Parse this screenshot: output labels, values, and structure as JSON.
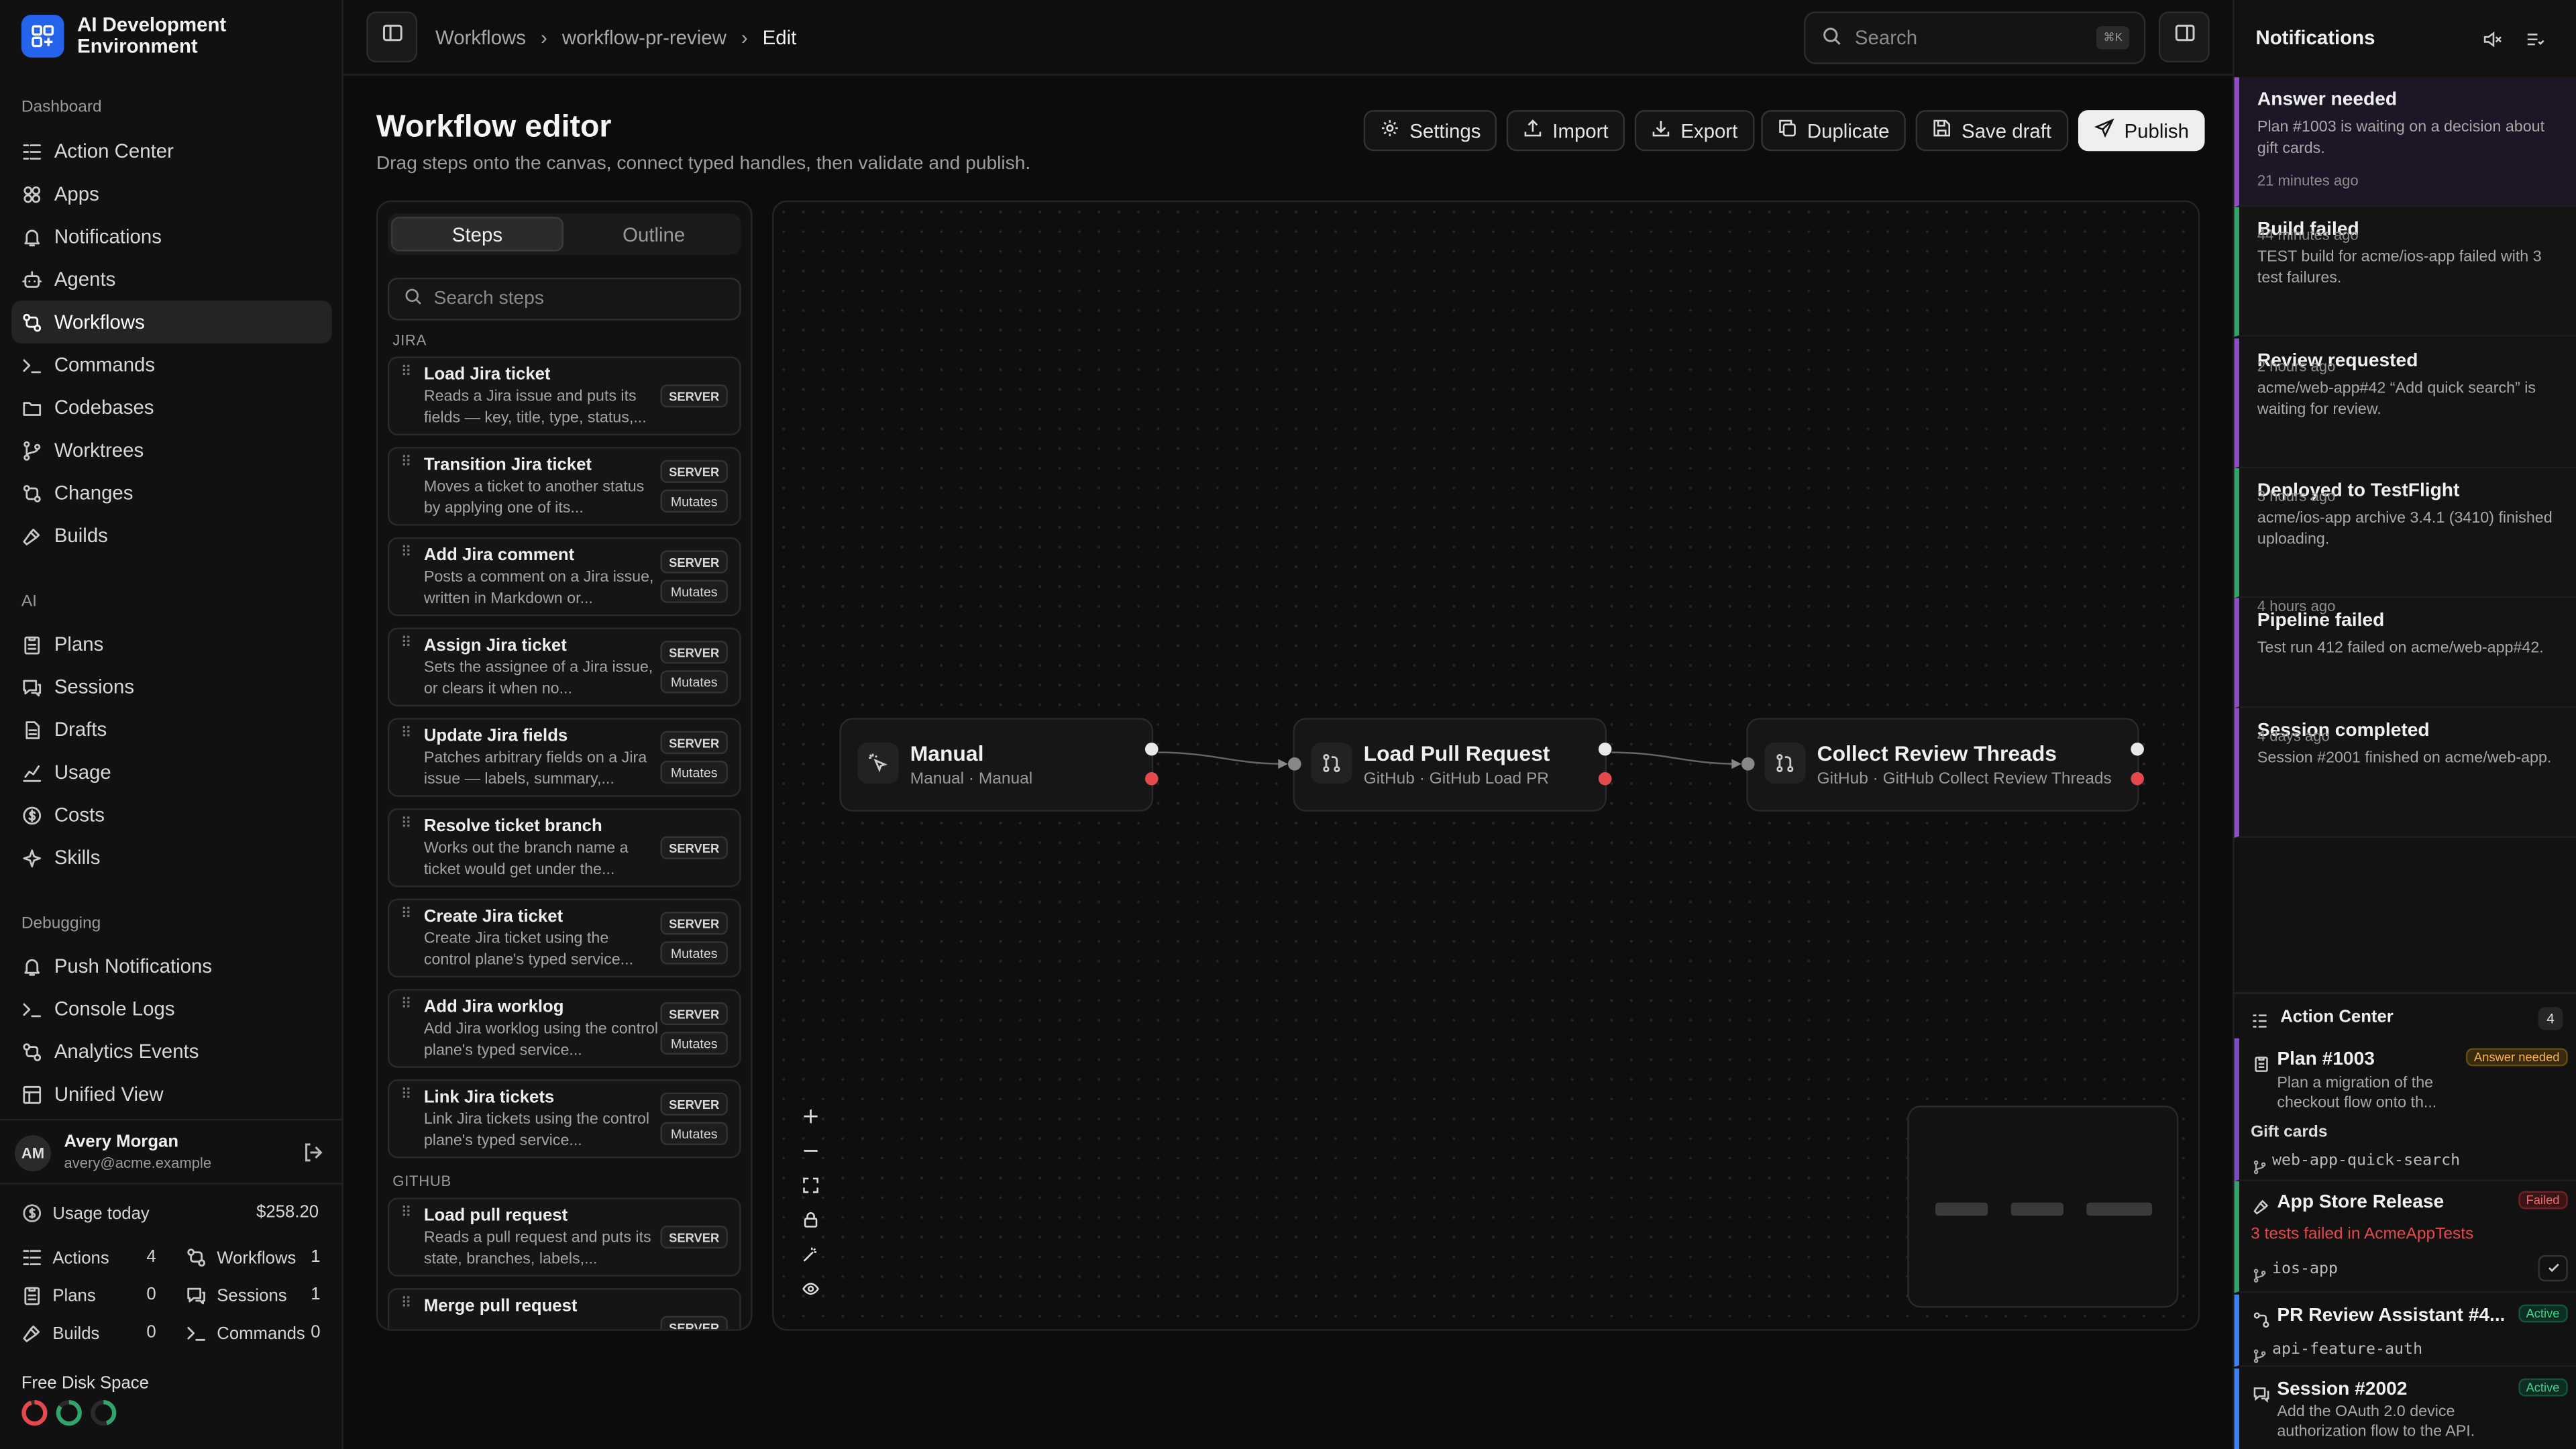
{
  "app": {
    "name": "AI Development Environment"
  },
  "sidebar": {
    "sections": [
      {
        "title": "Dashboard",
        "items": [
          {
            "label": "Action Center",
            "icon": "list-icon"
          },
          {
            "label": "Apps",
            "icon": "apps-icon"
          },
          {
            "label": "Notifications",
            "icon": "bell-icon"
          },
          {
            "label": "Agents",
            "icon": "bot-icon"
          },
          {
            "label": "Workflows",
            "icon": "workflow-icon",
            "active": true
          },
          {
            "label": "Commands",
            "icon": "terminal-icon"
          },
          {
            "label": "Codebases",
            "icon": "folder-icon"
          },
          {
            "label": "Worktrees",
            "icon": "branch-icon"
          },
          {
            "label": "Changes",
            "icon": "git-compare-icon"
          },
          {
            "label": "Builds",
            "icon": "hammer-icon"
          }
        ]
      },
      {
        "title": "AI",
        "items": [
          {
            "label": "Plans",
            "icon": "clipboard-icon"
          },
          {
            "label": "Sessions",
            "icon": "chat-icon"
          },
          {
            "label": "Drafts",
            "icon": "draft-icon"
          },
          {
            "label": "Usage",
            "icon": "chart-icon"
          },
          {
            "label": "Costs",
            "icon": "dollar-icon"
          },
          {
            "label": "Skills",
            "icon": "sparkle-icon"
          }
        ]
      },
      {
        "title": "Debugging",
        "items": [
          {
            "label": "Push Notifications",
            "icon": "bell-icon"
          },
          {
            "label": "Console Logs",
            "icon": "terminal-icon"
          },
          {
            "label": "Analytics Events",
            "icon": "workflow-icon"
          },
          {
            "label": "Unified View",
            "icon": "layout-icon"
          }
        ]
      }
    ],
    "user": {
      "initials": "AM",
      "name": "Avery Morgan",
      "email": "avery@acme.example"
    },
    "usage": {
      "label": "Usage today",
      "value": "$258.20"
    },
    "stats": [
      {
        "label": "Actions",
        "value": "4"
      },
      {
        "label": "Workflows",
        "value": "1"
      },
      {
        "label": "Plans",
        "value": "0"
      },
      {
        "label": "Sessions",
        "value": "1"
      },
      {
        "label": "Builds",
        "value": "0"
      },
      {
        "label": "Commands",
        "value": "0"
      }
    ],
    "disk": {
      "label": "Free Disk Space",
      "rings": [
        {
          "color": "#e5484d",
          "fraction": 0.95
        },
        {
          "color": "#30a46c",
          "fraction": 0.85
        },
        {
          "color": "#30a46c",
          "fraction": 0.45
        }
      ]
    }
  },
  "topbar": {
    "breadcrumbs": [
      "Workflows",
      "workflow-pr-review",
      "Edit"
    ],
    "search_placeholder": "Search",
    "search_shortcut": "⌘K"
  },
  "editor": {
    "title": "Workflow editor",
    "subtitle": "Drag steps onto the canvas, connect typed handles, then validate and publish.",
    "actions": [
      "Settings",
      "Import",
      "Export",
      "Duplicate",
      "Save draft",
      "Publish"
    ]
  },
  "palette": {
    "tabs": [
      "Steps",
      "Outline"
    ],
    "search_placeholder": "Search steps",
    "groups": [
      {
        "name": "JIRA",
        "items": [
          {
            "title": "Load Jira ticket",
            "desc": "Reads a Jira issue and puts its fields — key, title, type, status,...",
            "badges": [
              "SERVER"
            ]
          },
          {
            "title": "Transition Jira ticket",
            "desc": "Moves a ticket to another status by applying one of its...",
            "badges": [
              "SERVER",
              "Mutates"
            ]
          },
          {
            "title": "Add Jira comment",
            "desc": "Posts a comment on a Jira issue, written in Markdown or...",
            "badges": [
              "SERVER",
              "Mutates"
            ]
          },
          {
            "title": "Assign Jira ticket",
            "desc": "Sets the assignee of a Jira issue, or clears it when no...",
            "badges": [
              "SERVER",
              "Mutates"
            ]
          },
          {
            "title": "Update Jira fields",
            "desc": "Patches arbitrary fields on a Jira issue — labels, summary,...",
            "badges": [
              "SERVER",
              "Mutates"
            ]
          },
          {
            "title": "Resolve ticket branch",
            "desc": "Works out the branch name a ticket would get under the...",
            "badges": [
              "SERVER"
            ]
          },
          {
            "title": "Create Jira ticket",
            "desc": "Create Jira ticket using the control plane's typed service...",
            "badges": [
              "SERVER",
              "Mutates"
            ]
          },
          {
            "title": "Add Jira worklog",
            "desc": "Add Jira worklog using the control plane's typed service...",
            "badges": [
              "SERVER",
              "Mutates"
            ]
          },
          {
            "title": "Link Jira tickets",
            "desc": "Link Jira tickets using the control plane's typed service...",
            "badges": [
              "SERVER",
              "Mutates"
            ]
          }
        ]
      },
      {
        "name": "GITHUB",
        "items": [
          {
            "title": "Load pull request",
            "desc": "Reads a pull request and puts its state, branches, labels,...",
            "badges": [
              "SERVER"
            ]
          },
          {
            "title": "Merge pull request",
            "desc": "",
            "badges": [
              "SERVER"
            ]
          }
        ]
      }
    ]
  },
  "canvas": {
    "nodes": [
      {
        "title": "Manual",
        "subtitle": "Manual · Manual",
        "icon": "cursor-click-icon"
      },
      {
        "title": "Load Pull Request",
        "subtitle": "GitHub · GitHub Load PR",
        "icon": "pull-request-icon"
      },
      {
        "title": "Collect Review Threads",
        "subtitle": "GitHub · GitHub Collect Review Threads",
        "icon": "pull-request-icon"
      }
    ],
    "controls": [
      "zoom-in",
      "zoom-out",
      "fit-view",
      "lock",
      "auto-layout",
      "toggle-visibility"
    ]
  },
  "notifications": {
    "title": "Notifications",
    "items": [
      {
        "title": "Answer needed",
        "desc": "Plan #1003 is waiting on a decision about gift cards.",
        "time": "21 minutes ago",
        "accent": "#8e4ec6"
      },
      {
        "title": "Build failed",
        "desc": "TEST build for acme/ios-app failed with 3 test failures.",
        "time": "44 minutes ago",
        "accent": "#30a46c"
      },
      {
        "title": "Review requested",
        "desc": "acme/web-app#42 “Add quick search” is waiting for review.",
        "time": "2 hours ago",
        "accent": "#8e4ec6"
      },
      {
        "title": "Deployed to TestFlight",
        "desc": "acme/ios-app archive 3.4.1 (3410) finished uploading.",
        "time": "3 hours ago",
        "accent": "#30a46c"
      },
      {
        "title": "Pipeline failed",
        "desc": "Test run 412 failed on acme/web-app#42.",
        "time": "4 hours ago",
        "accent": "#8e4ec6"
      },
      {
        "title": "Session completed",
        "desc": "Session #2001 finished on acme/web-app.",
        "time": "4 days ago",
        "accent": "#8e4ec6"
      }
    ]
  },
  "action_center": {
    "title": "Action Center",
    "count": "4",
    "items": [
      {
        "title": "Plan #1003",
        "status": "Answer needed",
        "desc": "Plan a migration of the checkout flow onto th...",
        "extra": "Gift cards",
        "branch": "web-app-quick-search",
        "accent": "#8e4ec6"
      },
      {
        "title": "App Store Release",
        "status": "Failed",
        "desc": "3 tests failed in AcmeAppTests",
        "branch": "ios-app",
        "accent": "#30a46c"
      },
      {
        "title": "PR Review Assistant #4...",
        "status": "Active",
        "branch": "api-feature-auth",
        "accent": "#3b82f6"
      },
      {
        "title": "Session #2002",
        "status": "Active",
        "desc": "Add the OAuth 2.0 device authorization flow to the API.",
        "accent": "#3b82f6"
      }
    ]
  }
}
